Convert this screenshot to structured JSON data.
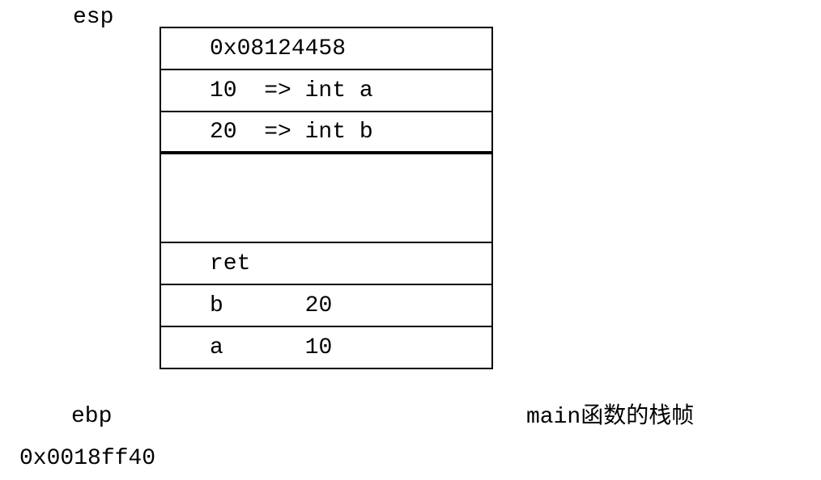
{
  "registers": {
    "esp_label": "esp",
    "ebp_label": "ebp",
    "ebp_address": "0x0018ff40"
  },
  "stack": {
    "cells": [
      {
        "text": "0x08124458"
      },
      {
        "text": "10  => int a"
      },
      {
        "text": "20  => int b"
      }
    ],
    "ret_label": "ret",
    "b_row_left": "b",
    "b_row_right": "20",
    "a_row_left": "a",
    "a_row_right": "10"
  },
  "side_label": "main函数的栈帧"
}
